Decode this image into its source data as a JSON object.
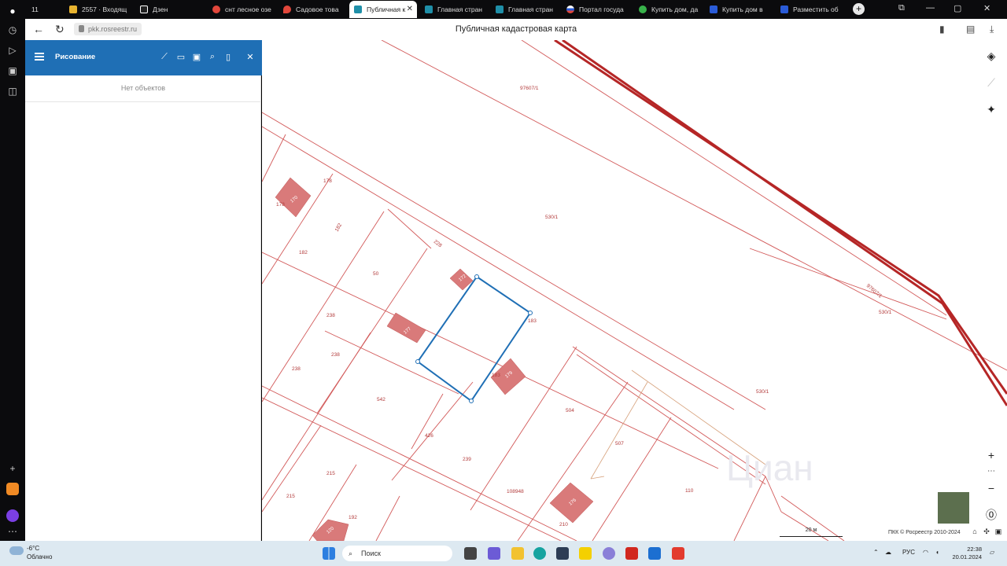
{
  "browser": {
    "tabs": [
      {
        "label": "11",
        "active": false
      },
      {
        "label": "2557 · Входящ",
        "active": false
      },
      {
        "label": "Дзен",
        "active": false
      },
      {
        "label": "снт лесное озе",
        "active": false
      },
      {
        "label": "Садовое това",
        "active": false
      },
      {
        "label": "Публичная к",
        "active": true
      },
      {
        "label": "Главная стран",
        "active": false
      },
      {
        "label": "Главная стран",
        "active": false
      },
      {
        "label": "Портал госуда",
        "active": false
      },
      {
        "label": "Купить дом, да",
        "active": false
      },
      {
        "label": "Купить дом в",
        "active": false
      },
      {
        "label": "Разместить об",
        "active": false
      }
    ],
    "url": "pkk.rosreestr.ru",
    "page_title": "Публичная кадастровая карта"
  },
  "panel": {
    "title": "Рисование",
    "empty_text": "Нет объектов"
  },
  "map": {
    "parcel_labels": [
      {
        "text": "97607/1"
      },
      {
        "text": "530/1"
      },
      {
        "text": "97607/1"
      },
      {
        "text": "530/1"
      },
      {
        "text": "530/1"
      },
      {
        "text": "178"
      },
      {
        "text": "178"
      },
      {
        "text": "182"
      },
      {
        "text": "182"
      },
      {
        "text": "228"
      },
      {
        "text": "50"
      },
      {
        "text": "238"
      },
      {
        "text": "238"
      },
      {
        "text": "238"
      },
      {
        "text": "183"
      },
      {
        "text": "183"
      },
      {
        "text": "542"
      },
      {
        "text": "504"
      },
      {
        "text": "426"
      },
      {
        "text": "239"
      },
      {
        "text": "507"
      },
      {
        "text": "108948"
      },
      {
        "text": "110"
      },
      {
        "text": "215"
      },
      {
        "text": "215"
      },
      {
        "text": "192"
      },
      {
        "text": "210"
      }
    ],
    "building_labels": [
      "170",
      "172",
      "177",
      "179",
      "176",
      "120"
    ],
    "scale": "20 м",
    "copyright": "ПКК © Росреестр 2010-2024",
    "watermark": "Циан"
  },
  "taskbar": {
    "temperature": "-6°C",
    "weather": "Облачно",
    "search": "Поиск",
    "language": "РУС",
    "time": "22:38",
    "date": "20.01.2024"
  },
  "colors": {
    "panel_header": "#1f6fb5",
    "parcel_line": "#d25a5a",
    "building_fill": "#d97a7a",
    "selection": "#1f6fb5",
    "road": "#b52626"
  }
}
